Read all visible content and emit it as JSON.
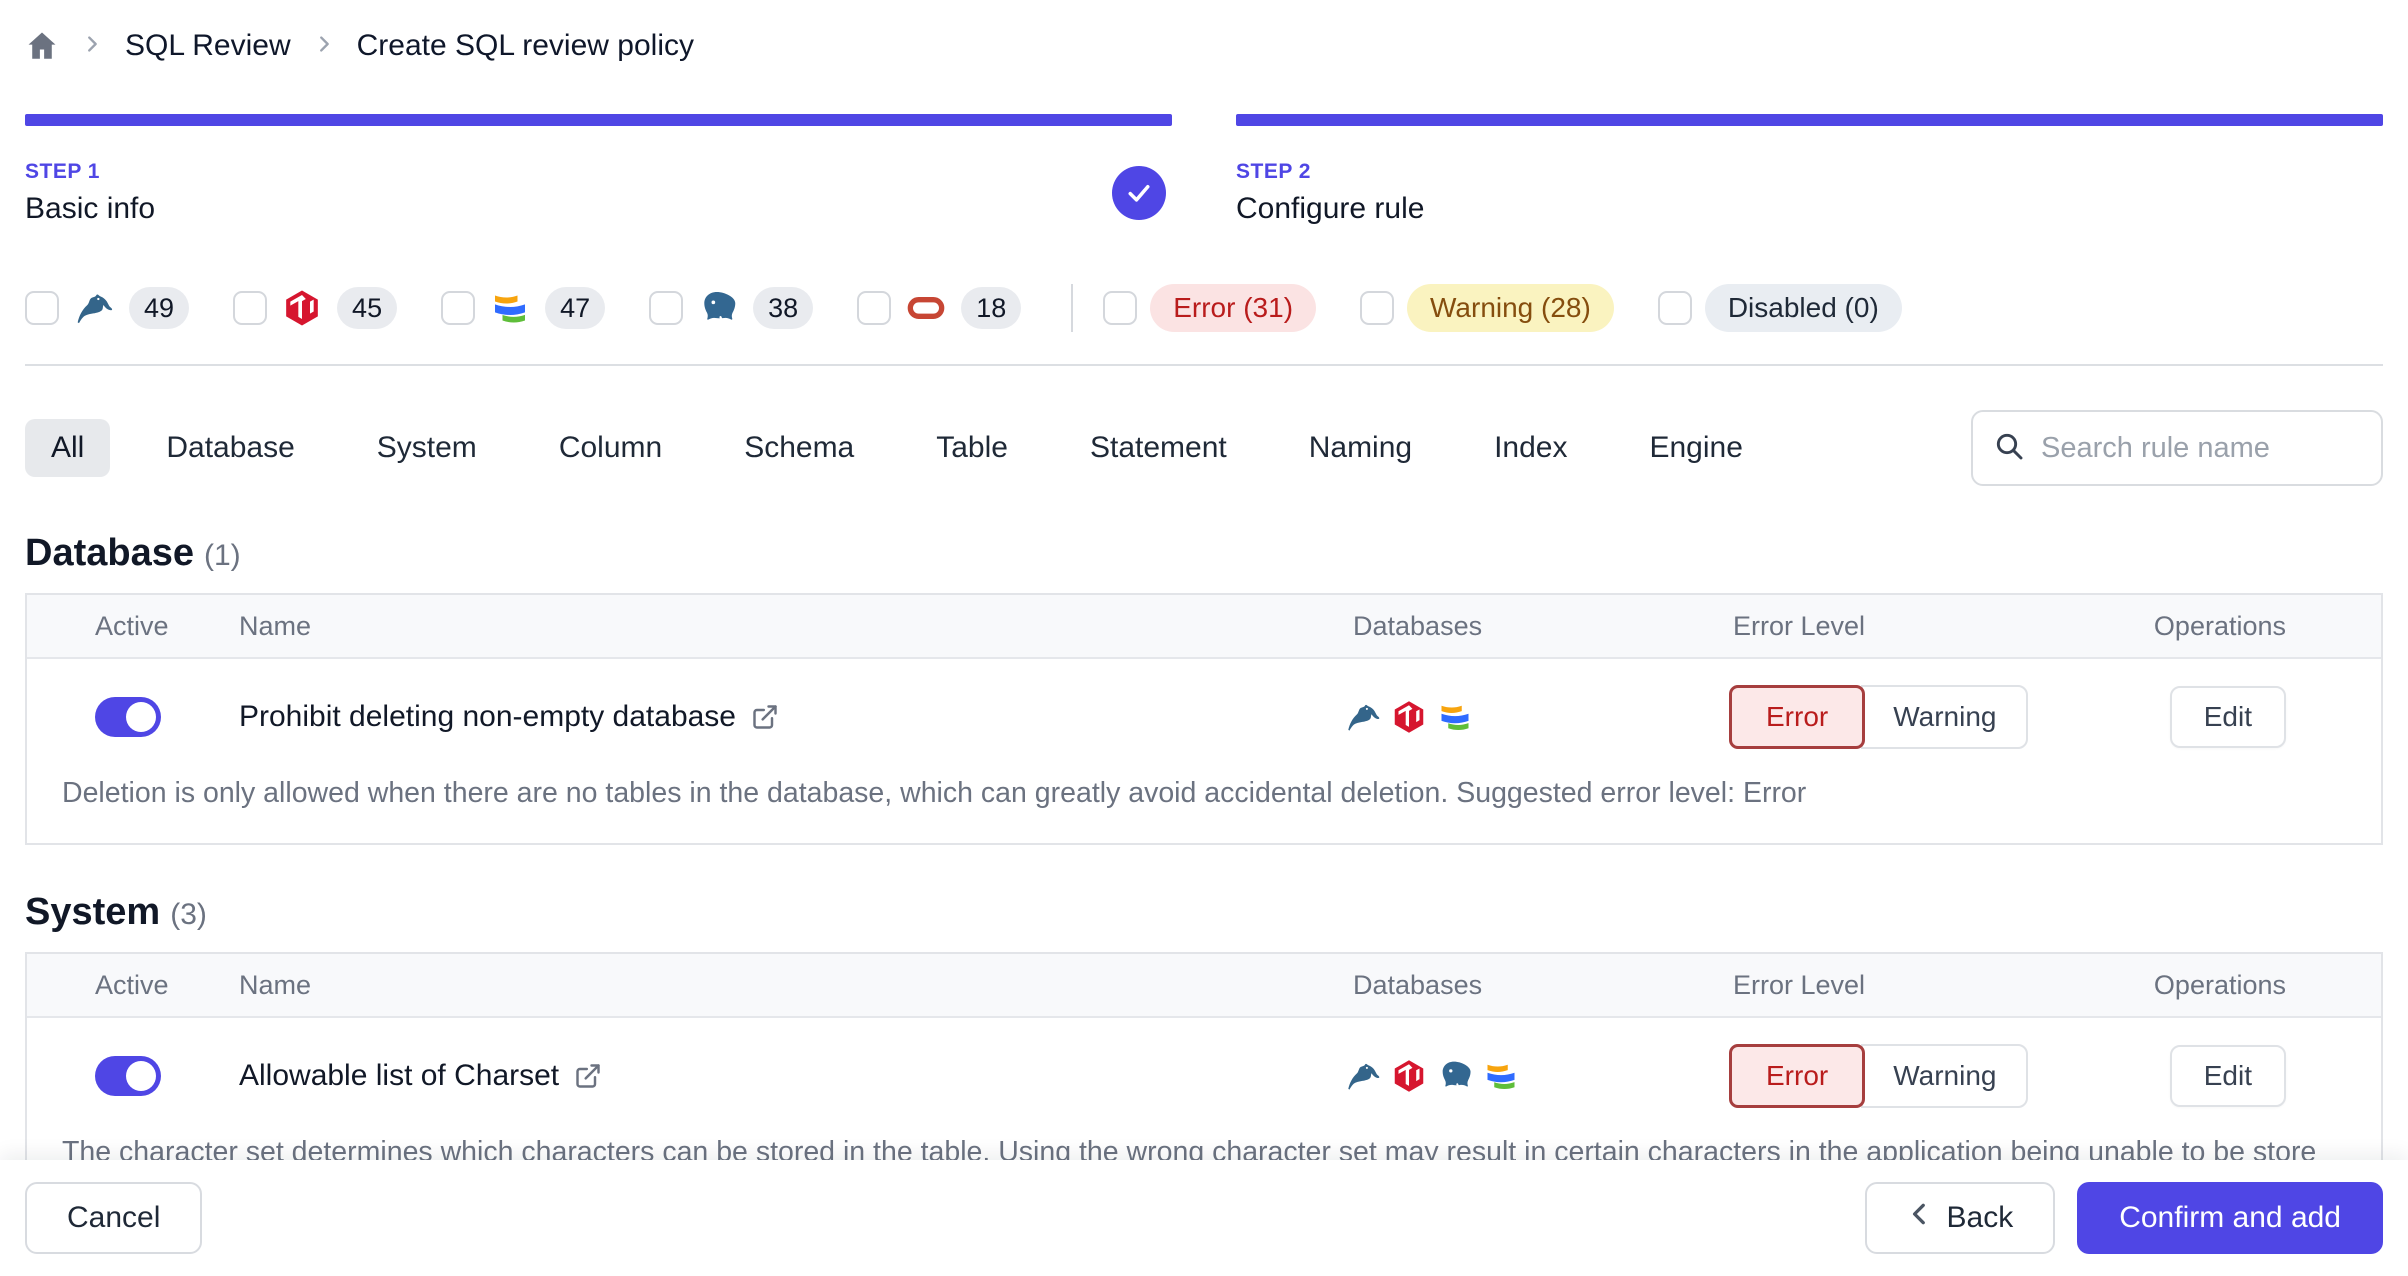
{
  "breadcrumb": {
    "home_icon": "home-icon",
    "items": [
      "SQL Review",
      "Create SQL review policy"
    ]
  },
  "steps": [
    {
      "label": "STEP 1",
      "title": "Basic info",
      "completed": true
    },
    {
      "label": "STEP 2",
      "title": "Configure rule",
      "completed": false
    }
  ],
  "filters": {
    "engines": [
      {
        "icon": "mysql-icon",
        "count": "49"
      },
      {
        "icon": "tidb-icon",
        "count": "45"
      },
      {
        "icon": "oceanbase-icon",
        "count": "47"
      },
      {
        "icon": "postgres-icon",
        "count": "38"
      },
      {
        "icon": "oracle-icon",
        "count": "18"
      }
    ],
    "levels": [
      {
        "label": "Error (31)",
        "type": "error"
      },
      {
        "label": "Warning (28)",
        "type": "warning"
      },
      {
        "label": "Disabled (0)",
        "type": "disabled"
      }
    ]
  },
  "tabs": [
    "All",
    "Database",
    "System",
    "Column",
    "Schema",
    "Table",
    "Statement",
    "Naming",
    "Index",
    "Engine"
  ],
  "active_tab": "All",
  "search": {
    "placeholder": "Search rule name"
  },
  "level_buttons": {
    "error": "Error",
    "warning": "Warning"
  },
  "operations": {
    "edit": "Edit"
  },
  "sections": [
    {
      "title": "Database",
      "count": "(1)",
      "columns": [
        "Active",
        "Name",
        "Databases",
        "Error Level",
        "Operations"
      ],
      "rules": [
        {
          "name": "Prohibit deleting non-empty database",
          "active": true,
          "engines": [
            "mysql",
            "tidb",
            "oceanbase"
          ],
          "level": "Error",
          "description": "Deletion is only allowed when there are no tables in the database, which can greatly avoid accidental deletion. Suggested error level: Error"
        }
      ]
    },
    {
      "title": "System",
      "count": "(3)",
      "columns": [
        "Active",
        "Name",
        "Databases",
        "Error Level",
        "Operations"
      ],
      "rules": [
        {
          "name": "Allowable list of Charset",
          "active": true,
          "engines": [
            "mysql",
            "tidb",
            "postgres",
            "oceanbase"
          ],
          "level": "Error",
          "description": "The character set determines which characters can be stored in the table. Using the wrong character set may result in certain characters in the application being unable to be stored and displayed correctly, such as CJK and Emoji. Suggested error level: Error"
        }
      ]
    }
  ],
  "footer": {
    "cancel": "Cancel",
    "back": "Back",
    "confirm": "Confirm and add"
  },
  "colors": {
    "accent": "#4f46e5",
    "error_text": "#b91c1c",
    "error_bg": "#fce8e8",
    "error_border": "#a63e3e",
    "warning_text": "#854d0e",
    "warning_bg": "#faf3c0",
    "disabled_bg": "#e9edf2",
    "muted_text": "#6b7280",
    "border": "#e2e4e8"
  }
}
